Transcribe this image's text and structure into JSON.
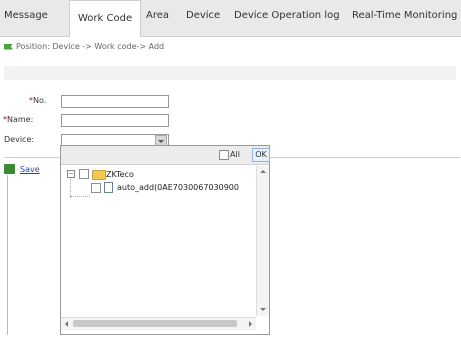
{
  "tabs": [
    {
      "label": "Message"
    },
    {
      "label": "Work Code",
      "active": true
    },
    {
      "label": "Area"
    },
    {
      "label": "Device"
    },
    {
      "label": "Device Operation log"
    },
    {
      "label": "Real-Time Monitoring"
    }
  ],
  "breadcrumb": "Position: Device -> Work code-> Add",
  "form": {
    "no_label": "No.",
    "name_label": "Name:",
    "device_label": "Device:",
    "no_value": "",
    "name_value": "",
    "device_value": "",
    "required_mark": "*",
    "save_label": "Save"
  },
  "dropdown": {
    "all_label": "All",
    "ok_label": "OK",
    "tree": {
      "root": "ZKTeco",
      "child": "auto_add(0AE7030067030900"
    }
  },
  "colors": {
    "flag": "#4aa33a",
    "save_icon": "#3b8a32",
    "folder": "#f2c94c",
    "required": "#cc0000"
  }
}
